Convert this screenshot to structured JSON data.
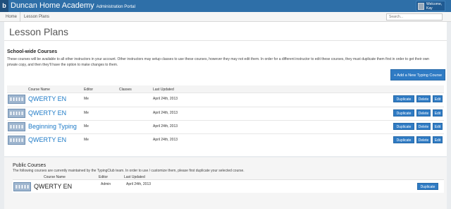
{
  "header": {
    "logo": "b",
    "app_title": "Duncan Home Academy",
    "app_subtitle": "Administration Portal",
    "user_greeting": "Welcome,",
    "user_name": "Kay"
  },
  "breadcrumb": {
    "home": "Home",
    "current": "Lesson Plans"
  },
  "search": {
    "placeholder": "Search..."
  },
  "page": {
    "title": "Lesson Plans"
  },
  "school_wide": {
    "heading": "School-wide Courses",
    "description": "These courses will be available to all other instructors in your account. Other instructors may setup classes to use these courses, however they may not edit them. In order for a different instructor to edit these courses, they must duplicate them first in order to get their own private copy, and then they'll have the option to make changes to them.",
    "add_button": "+ Add a New Typing Course",
    "columns": [
      "Course Name",
      "Editor",
      "Classes",
      "Last Updated"
    ],
    "actions": {
      "duplicate": "Duplicate",
      "delete": "Delete",
      "edit": "Edit"
    },
    "rows": [
      {
        "name": "QWERTY EN",
        "editor": "Me",
        "classes": "",
        "updated": "April 24th, 2013"
      },
      {
        "name": "QWERTY EN",
        "editor": "Me",
        "classes": "",
        "updated": "April 24th, 2013"
      },
      {
        "name": "Beginning Typing",
        "editor": "Me",
        "classes": "",
        "updated": "April 24th, 2013"
      },
      {
        "name": "QWERTY EN",
        "editor": "Me",
        "classes": "",
        "updated": "April 24th, 2013"
      }
    ]
  },
  "public": {
    "heading": "Public Courses",
    "description": "The following courses are currently maintained by the TypingClub team. In order to use / customize them, please first duplicate your selected course.",
    "columns": [
      "Course Name",
      "Editor",
      "Last Updated"
    ],
    "duplicate": "Duplicate",
    "rows": [
      {
        "name": "QWERTY EN",
        "editor": "Admin",
        "updated": "April 24th, 2013"
      }
    ]
  }
}
